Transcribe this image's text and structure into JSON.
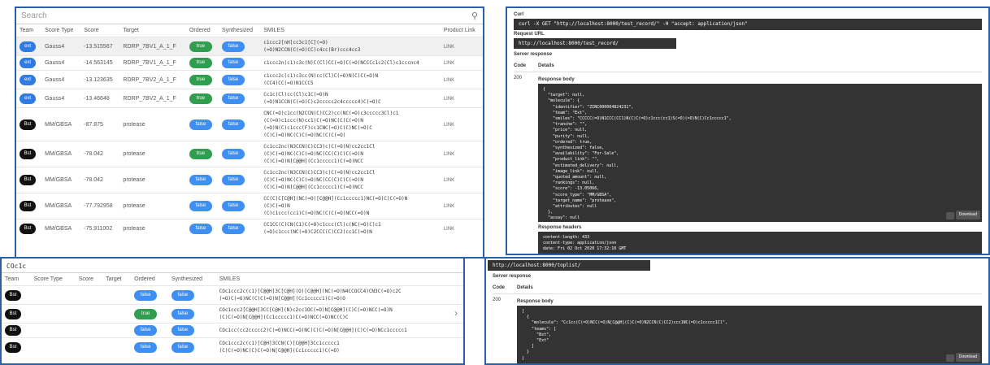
{
  "tableA": {
    "search_placeholder": "Search",
    "headers": [
      "Team",
      "Score Type",
      "Score",
      "Target",
      "Ordered",
      "Synthesized",
      "SMILES",
      "Product Link"
    ],
    "rows": [
      {
        "team": "ext",
        "team_style": "blue",
        "score_type": "Gauss4",
        "score": "-13.515567",
        "target": "RDRP_7BV1_A_1_F",
        "ordered": "true",
        "synthesized": "false",
        "smiles": "c1ccc2[nH]cc3c1[C](=O)\n(=O)N2CCN(C(=O)CC)c4cc(Br)ccc4cc3",
        "link": "LINK",
        "selected": true
      },
      {
        "team": "ext",
        "team_style": "blue",
        "score_type": "Gauss4",
        "score": "-14.563145",
        "target": "RDRP_7BV1_A_1_F",
        "ordered": "true",
        "synthesized": "false",
        "smiles": "c1ccc2n(c1)c3c(N)C(Cl)CC(=O)C(=O)NCCCc1c2(Cl)c1cccnc4",
        "link": "LINK",
        "selected": false
      },
      {
        "team": "ext",
        "team_style": "blue",
        "score_type": "Gauss4",
        "score": "-13.123635",
        "target": "RDRP_7BV2_A_1_F",
        "ordered": "true",
        "synthesized": "false",
        "smiles": "c1ccc2c(c1)c3cc(N)cc(Cl)C(=O)N(C)C(=O)N\n(CC4)CC(=O)N1CCC5",
        "link": "LINK",
        "selected": false
      },
      {
        "team": "ext",
        "team_style": "blue",
        "score_type": "Gauss4",
        "score": "-13.46648",
        "target": "RDRP_7BV2_A_1_F",
        "ordered": "true",
        "synthesized": "false",
        "smiles": "Cc1c(Cl)cc(Cl)c1C(=O)N\n(=O)N1CCN(C(=O)C)c2ccccc2c4ccccc4)C(=O)C",
        "link": "LINK",
        "selected": false
      },
      {
        "team": "Bst",
        "team_style": "black",
        "score_type": "MM/GBSA",
        "score": "-87.875",
        "target": "protease",
        "ordered": "false",
        "synthesized": "false",
        "smiles": "CNC(=O)c1cc(N2CCN(C)CC2)cc(NC(=O)c3ccccc3Cl)c1\n(C(=O)c1ccc(N)cc1)C(=O)NC(C)C(=O)N\n(=O)N(C)c1ccc(F)cc1CNC(=O)C(C)NC(=O)C\n(C)C(=O)NC(C)C(=O)NC(C)C(=O)",
        "link": "LINK",
        "selected": false
      },
      {
        "team": "Bst",
        "team_style": "black",
        "score_type": "MM/GBSA",
        "score": "-78.042",
        "target": "protease",
        "ordered": "true",
        "synthesized": "false",
        "smiles": "Cc1cc2nc(N3CCN(C)CC3)c(C(=O)N)cc2cc1Cl\n(C)C(=O)NC(C)C(=O)NC(CC(C)C)C(=O)N\n(C)C(=O)N[C@@H](Cc1ccccc1)C(=O)NCC",
        "link": "LINK",
        "selected": false
      },
      {
        "team": "Bst",
        "team_style": "black",
        "score_type": "MM/GBSA",
        "score": "-78.042",
        "target": "protease",
        "ordered": "false",
        "synthesized": "false",
        "smiles": "Cc1cc2nc(N3CCN(C)CC3)c(C(=O)N)cc2cc1Cl\n(C)C(=O)NC(C)C(=O)NC(CC(C)C)C(=O)N\n(C)C(=O)N[C@@H](Cc1ccccc1)C(=O)NCC",
        "link": "LINK",
        "selected": false
      },
      {
        "team": "Bst",
        "team_style": "black",
        "score_type": "MM/GBSA",
        "score": "-77.792958",
        "target": "protease",
        "ordered": "false",
        "synthesized": "false",
        "smiles": "CC(C)C[C@H](NC(=O)[C@@H](Cc1ccccc1)NC(=O)C)C(=O)N\n(C)C(=O)N\n(C)c1ccc(cc1)C(=O)NC(C)C(=O)NCC(=O)N",
        "link": "LINK",
        "selected": false
      },
      {
        "team": "Bst",
        "team_style": "black",
        "score_type": "MM/GBSA",
        "score": "-75.911002",
        "target": "protease",
        "ordered": "false",
        "synthesized": "false",
        "smiles": "CC1CC(C)CN(C1)C(=O)c1ccc(Cl)c(NC(=O)C)c1\n(=O)c1ccc(NC(=O)C2CCC(C)CC2)cc1C(=O)N",
        "link": "LINK",
        "selected": false
      }
    ]
  },
  "tableB": {
    "title": "COc1c",
    "headers": [
      "Team",
      "Score Type",
      "Score",
      "Target",
      "Ordered",
      "Synthesized",
      "SMILES"
    ],
    "rows": [
      {
        "team": "Bst",
        "ordered": "false",
        "synthesized": "false",
        "smiles": "COc1ccc2c(c1)[C@@H]3C[C@H](O)[C@@H](NC(=O)N4CCOCC4)CN3C(=O)c2C\n(=O)C(=O)NC(C)C(=O)N[C@@H](Cc1ccccc1)C(=O)O"
      },
      {
        "team": "Bst",
        "ordered": "true",
        "synthesized": "false",
        "smiles": "COc1ccc2[C@@H]3CC[C@H](N)c2cc1OC(=O)N[C@@H](C)C(=O)NCC(=O)N\n(C)C(=O)N[C@@H](Cc1ccccc1)C(=O)NCC(=O)NC(C)C"
      },
      {
        "team": "Bst",
        "ordered": "false",
        "synthesized": "false",
        "smiles": "COc1cc(cc2ccccc2)C(=O)NCC(=O)NC(C)C(=O)N[C@@H](C)C(=O)NCc1ccccc1"
      },
      {
        "team": "Bst",
        "ordered": "false",
        "synthesized": "false",
        "smiles": "COc1ccc2c(c1)[C@H]3CCN(C)[C@@H]3Cc1ccccc1\n(C)C(=O)NC(C)C(=O)N[C@@H](Cc1ccccc1)C(=O)"
      }
    ]
  },
  "apiC": {
    "curl_label": "Curl",
    "curl_cmd": "curl -X GET \"http://localhost:8000/test_record/\" -H \"accept: application/json\"",
    "url_label": "Request URL",
    "url": "http://localhost:8000/test_record/",
    "server_response": "Server response",
    "code_h": "Code",
    "details_h": "Details",
    "code": "200",
    "body_label": "Response body",
    "body_lines": [
      "{",
      "  \"target\": null,",
      "  \"molecule\": {",
      "    \"identifier\": \"ZINC000004824231\",",
      "    \"team\": \"Ext\",",
      "    \"smiles\": \"CCCCC(=O)N1CCC(CC1)N(C)C(=O)c1ccc(cc1)S(=O)(=O)N(C)Cc1ccccc1\",",
      "    \"tranche\": \"\",",
      "    \"price\": null,",
      "    \"purity\": null,",
      "    \"ordered\": true,",
      "    \"synthesized\": false,",
      "    \"availability\": \"For-Sale\",",
      "    \"product_link\": \"\",",
      "    \"estimated_delivery\": null,",
      "    \"image_link\": null,",
      "    \"quoted_amount\": null,",
      "    \"rankings\": null,",
      "    \"score\": -13.05066,",
      "    \"score_type\": \"MM/GBSA\",",
      "    \"target_name\": \"protease\",",
      "    \"attributes\": null",
      "  },",
      "  \"assay\": null",
      "}"
    ],
    "download": "Download",
    "headers_label": "Response headers",
    "headers_lines": [
      "content-length: 433",
      "content-type: application/json",
      "date: Fri 02 Oct 2020 17:32:10 GMT"
    ]
  },
  "apiD": {
    "url": "http://localhost:8000/toplist/",
    "server_response": "Server response",
    "code_h": "Code",
    "details_h": "Details",
    "code": "200",
    "body_label": "Response body",
    "body_lines": [
      "[",
      "  {",
      "    \"molecule\": \"Cc1cc(C(=O)NCC(=O)N[C@@H](C)C(=O)N2CCN(C)CC2)ccc1NC(=O)c1ccccc1Cl\",",
      "    \"teams\": [",
      "      \"Bst\",",
      "      \"Ext\"",
      "    ]",
      "  }",
      "]"
    ],
    "download": "Download"
  }
}
